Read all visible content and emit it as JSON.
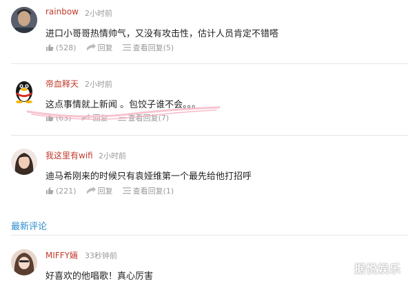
{
  "comments": [
    {
      "user": "rainbow",
      "time": "2小时前",
      "text": "进口小哥哥热情帅气，又没有攻击性，估计人员肯定不错嗒",
      "likes": "(528)",
      "reply": "回复",
      "view_replies": "查看回复(5)"
    },
    {
      "user": "帝血释天",
      "time": "2小时前",
      "text": "这点事情就上新闻 。包饺子谁不会。。。",
      "likes": "(63)",
      "reply": "回复",
      "view_replies": "查看回复(7)"
    },
    {
      "user": "我这里有wifi",
      "time": "2小时前",
      "text": "迪马希刚来的时候只有袁娅维第一个最先给他打招呼",
      "likes": "(221)",
      "reply": "回复",
      "view_replies": "查看回复(1)"
    }
  ],
  "latest_section": {
    "title": "最新评论",
    "comment": {
      "user": "MIFFY婳",
      "time": "33秒钟前",
      "text": "好喜欢的他唱歌！真心厉害"
    }
  },
  "watermark": "据悦娱乐",
  "colors": {
    "username": "#c0392b",
    "section_title": "#2b8ccf",
    "muted": "#999999"
  },
  "icons": [
    "like-icon",
    "reply-icon",
    "view-replies-icon"
  ]
}
